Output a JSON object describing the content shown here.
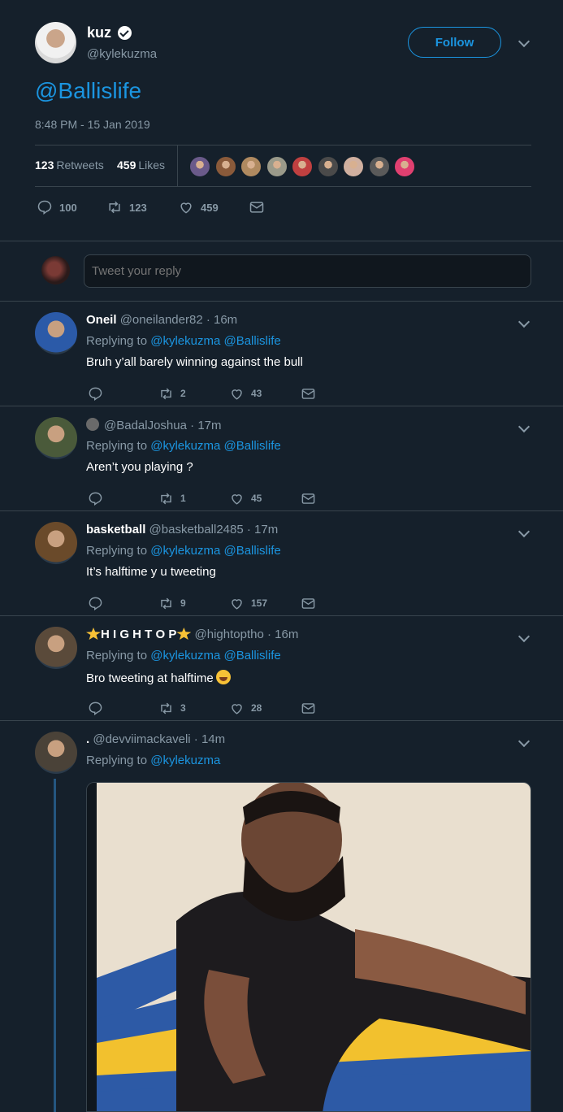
{
  "main_tweet": {
    "author_name": "kuz",
    "author_handle": "@kylekuzma",
    "follow_label": "Follow",
    "text": "@Ballislife",
    "timestamp": "8:48 PM - 15 Jan 2019",
    "retweets_count": "123",
    "retweets_label": "Retweets",
    "likes_count": "459",
    "likes_label": "Likes",
    "actions": {
      "replies": "100",
      "retweets": "123",
      "likes": "459"
    },
    "liker_colors": [
      "#6a5a8a",
      "#8a5a3a",
      "#b08a60",
      "#9a9a8a",
      "#c04040",
      "#4a4a4a",
      "#d0b0a0",
      "#5a5a5a",
      "#e04070"
    ]
  },
  "reply_box": {
    "placeholder": "Tweet your reply"
  },
  "replies": [
    {
      "name": "Oneil",
      "handle": "@oneilander82",
      "time": "16m",
      "replying_label": "Replying to",
      "mentions": [
        "@kylekuzma",
        "@Ballislife"
      ],
      "text": "Bruh y’all barely winning against the bull",
      "retweets": "2",
      "likes": "43",
      "avatar_color": "#2b5aa8"
    },
    {
      "name": "",
      "handle": "@BadalJoshua",
      "time": "17m",
      "replying_label": "Replying to",
      "mentions": [
        "@kylekuzma",
        "@Ballislife"
      ],
      "text": "Aren’t you playing ?",
      "retweets": "1",
      "likes": "45",
      "avatar_color": "#4a5a3a"
    },
    {
      "name": "basketball",
      "handle": "@basketball2485",
      "time": "17m",
      "replying_label": "Replying to",
      "mentions": [
        "@kylekuzma",
        "@Ballislife"
      ],
      "text": "It’s halftime y u tweeting",
      "retweets": "9",
      "likes": "157",
      "avatar_color": "#6a4a2a"
    },
    {
      "name": "H I G H T O P",
      "handle": "@hightoptho",
      "time": "16m",
      "replying_label": "Replying to",
      "mentions": [
        "@kylekuzma",
        "@Ballislife"
      ],
      "text": "Bro tweeting at halftime",
      "retweets": "3",
      "likes": "28",
      "avatar_color": "#5a4a3a"
    },
    {
      "name": ".",
      "handle": "@devviimackaveli",
      "time": "14m",
      "replying_label": "Replying to",
      "mentions": [
        "@kylekuzma"
      ],
      "avatar_color": "#4a4238"
    }
  ],
  "separator": "·",
  "colors": {
    "background": "#15202b",
    "accent": "#1b95e0",
    "muted": "#8899a6",
    "border": "#38444d"
  }
}
